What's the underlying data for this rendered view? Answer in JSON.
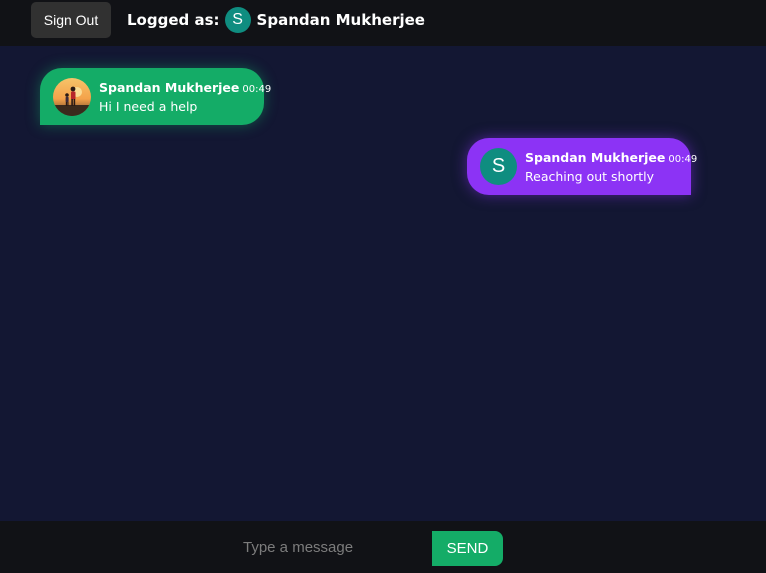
{
  "header": {
    "signout_label": "Sign Out",
    "logged_label": "Logged as:",
    "user_initial": "S",
    "user_name": "Spandan Mukherjee"
  },
  "messages": [
    {
      "sender": "Spandan Mukherjee",
      "time": "00:49",
      "text": "Hi I need a help",
      "side": "left",
      "avatar": "photo",
      "color": "#14ac67"
    },
    {
      "sender": "Spandan Mukherjee",
      "time": "00:49",
      "text": "Reaching out shortly",
      "side": "right",
      "avatar_initial": "S",
      "color": "#8c33f5"
    }
  ],
  "composer": {
    "placeholder": "Type a message",
    "value": "",
    "send_label": "SEND"
  },
  "colors": {
    "background": "#131733",
    "bar": "#111216",
    "accent_green": "#14ac67",
    "accent_purple": "#8c33f5",
    "avatar_teal": "#0f8d80"
  }
}
